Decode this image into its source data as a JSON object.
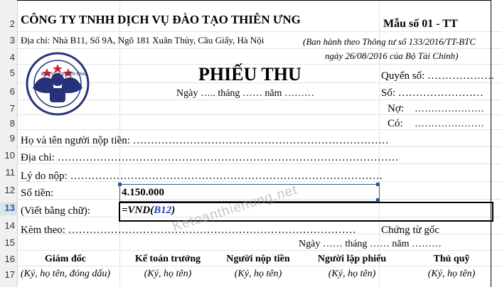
{
  "rows": [
    "2",
    "3",
    "4",
    "5",
    "6",
    "7",
    "8",
    "9",
    "10",
    "11",
    "12",
    "13",
    "14",
    "15",
    "16",
    "17"
  ],
  "company": "CÔNG TY TNHH DỊCH VỤ ĐÀO TẠO THIÊN ƯNG",
  "address": "Địa chỉ: Nhà B11, Số 9A, Ngõ 181 Xuân Thủy, Cầu Giấy, Hà Nội",
  "form_code": "Mẫu số 01 - TT",
  "issued_line1": "(Ban hành theo Thông tư số 133/2016/TT-BTC",
  "issued_line2": "ngày 26/08/2016 của Bộ Tài Chính)",
  "logo_text": "KẾ TOÁN THIÊN ƯNG",
  "title": "PHIẾU THU",
  "date_line": "Ngày ….. tháng …… năm ………",
  "book_no": "Quyển số: ……………….",
  "doc_no": "Số: ……………………",
  "debit": "Nợ:",
  "debit_dots": "…………………",
  "credit": "Có:",
  "credit_dots": "…………………",
  "payer": "Họ và tên người nộp tiền: ………………………………………………………………",
  "addr_field": "Địa chỉ: ……………………………………………………………………………………",
  "reason": "Lý do nộp: …………………………………………………………………………….",
  "amount_label": "Số tiền:",
  "amount_value": "4.150.000",
  "words_label": "(Viết bằng chữ):",
  "formula_prefix": "=VND(",
  "formula_ref": "B12",
  "formula_suffix": ")",
  "attach": "Kèm theo: ………………………………………………………………………",
  "orig_docs": "Chứng từ gốc",
  "sign_date": "Ngày …… tháng …… năm ………",
  "signers": [
    {
      "title": "Giám đốc",
      "note": "(Ký, họ tên, đóng dấu)"
    },
    {
      "title": "Kế toán trưởng",
      "note": "(Ký, họ tên)"
    },
    {
      "title": "Người nộp tiền",
      "note": "(Ký, họ tên)"
    },
    {
      "title": "Người lập phiếu",
      "note": "(Ký, họ tên)"
    },
    {
      "title": "Thủ quỹ",
      "note": "(Ký, họ tên)"
    }
  ],
  "watermark": "Ketoanthienung.net",
  "active_row": "13"
}
